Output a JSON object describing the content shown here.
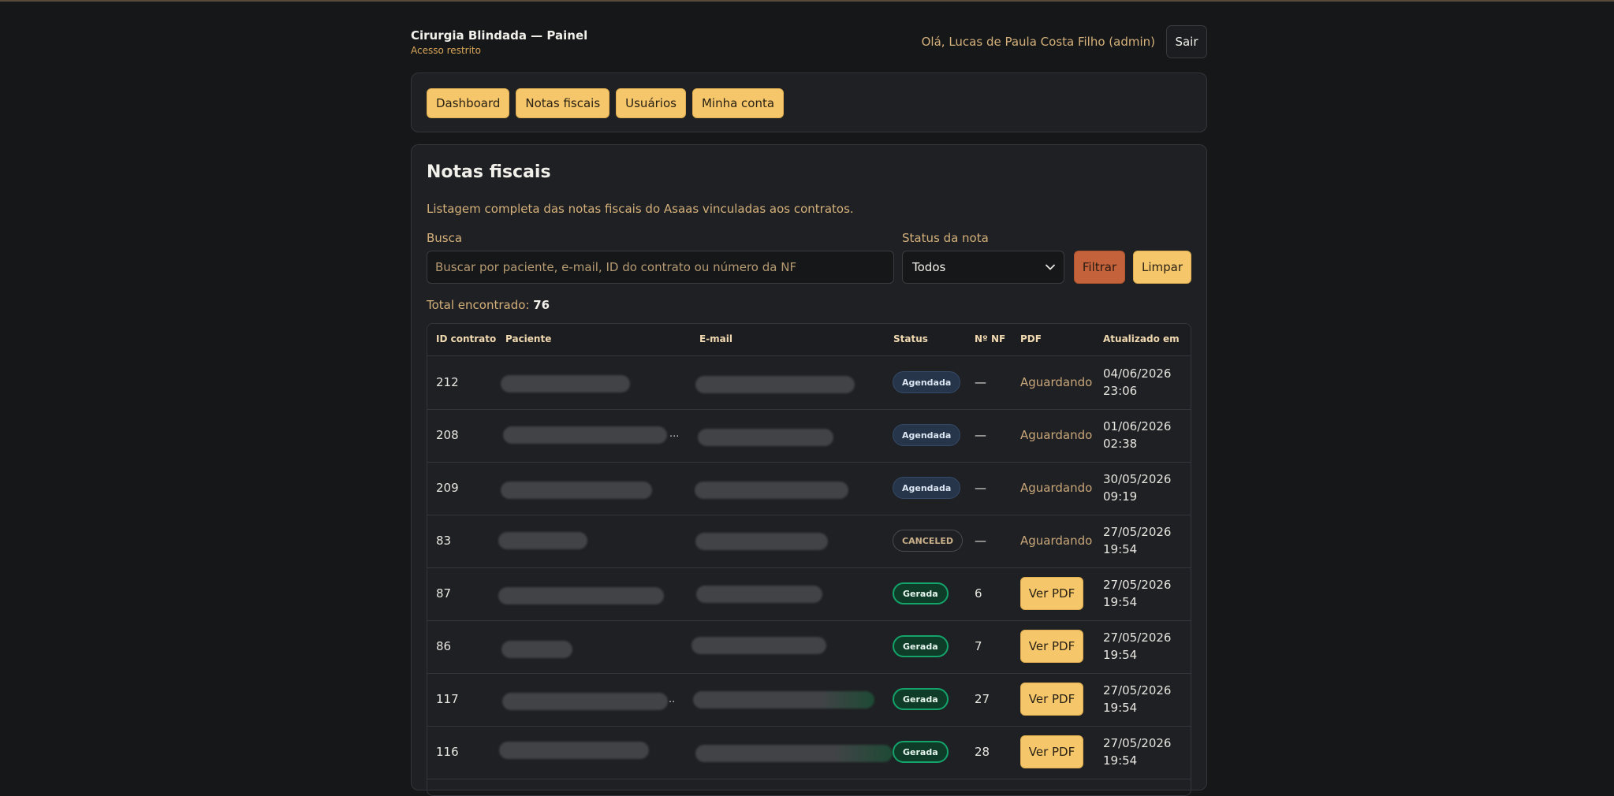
{
  "header": {
    "title": "Cirurgia Blindada — Painel",
    "subtitle": "Acesso restrito",
    "greeting": "Olá, Lucas de Paula Costa Filho (admin)",
    "logout_label": "Sair"
  },
  "nav": {
    "items": [
      {
        "label": "Dashboard"
      },
      {
        "label": "Notas fiscais"
      },
      {
        "label": "Usuários"
      },
      {
        "label": "Minha conta"
      }
    ]
  },
  "main": {
    "title": "Notas fiscais",
    "description": "Listagem completa das notas fiscais do Asaas vinculadas aos contratos.",
    "search_label": "Busca",
    "search_placeholder": "Buscar por paciente, e-mail, ID do contrato ou número da NF",
    "status_label": "Status da nota",
    "status_value": "Todos",
    "filter_label": "Filtrar",
    "clear_label": "Limpar",
    "total_label": "Total encontrado:",
    "total_value": "76"
  },
  "table": {
    "headers": [
      "ID contrato",
      "Paciente",
      "E-mail",
      "Status",
      "Nº NF",
      "PDF",
      "Atualizado em"
    ],
    "rows": [
      {
        "id": "212",
        "status": "Agendada",
        "nf": "—",
        "pdf": "Aguardando",
        "date": "04/06/2026",
        "time": "23:06"
      },
      {
        "id": "208",
        "status": "Agendada",
        "nf": "—",
        "pdf": "Aguardando",
        "date": "01/06/2026",
        "time": "02:38"
      },
      {
        "id": "209",
        "status": "Agendada",
        "nf": "—",
        "pdf": "Aguardando",
        "date": "30/05/2026",
        "time": "09:19"
      },
      {
        "id": "83",
        "status": "CANCELED",
        "nf": "—",
        "pdf": "Aguardando",
        "date": "27/05/2026",
        "time": "19:54"
      },
      {
        "id": "87",
        "status": "Gerada",
        "nf": "6",
        "pdf": "Ver PDF",
        "date": "27/05/2026",
        "time": "19:54"
      },
      {
        "id": "86",
        "status": "Gerada",
        "nf": "7",
        "pdf": "Ver PDF",
        "date": "27/05/2026",
        "time": "19:54"
      },
      {
        "id": "117",
        "status": "Gerada",
        "nf": "27",
        "pdf": "Ver PDF",
        "date": "27/05/2026",
        "time": "19:54"
      },
      {
        "id": "116",
        "status": "Gerada",
        "nf": "28",
        "pdf": "Ver PDF",
        "date": "27/05/2026",
        "time": "19:54"
      }
    ]
  },
  "colors": {
    "accent": "#f5c66a",
    "filter": "#c4623b",
    "background": "#161719",
    "card": "#1f2023",
    "badge_gerada": "#14a36b"
  },
  "icons": {
    "select": "chevron-down-icon"
  }
}
